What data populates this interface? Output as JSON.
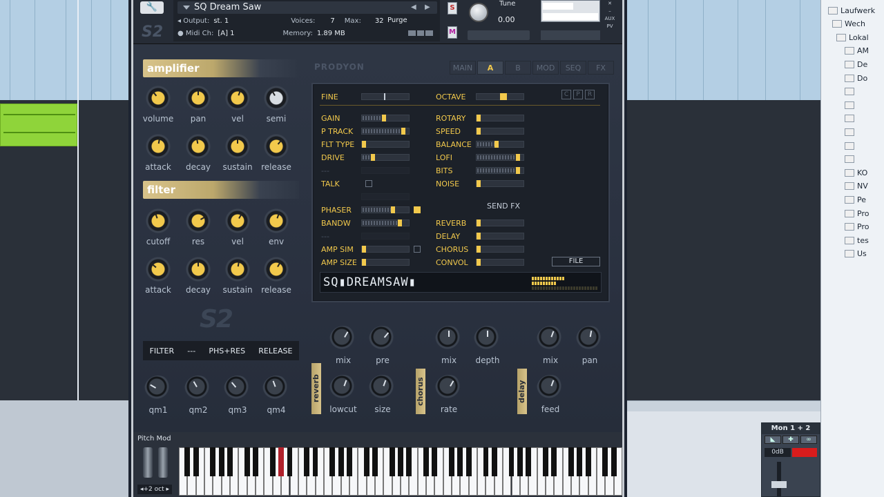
{
  "daw": {
    "browser_items": [
      "Laufwerk",
      "Wech",
      "Lokal",
      "AM",
      "De",
      "Do",
      "",
      "",
      "",
      "",
      "",
      "",
      "KO",
      "NV",
      "Pe",
      "Pro",
      "Pro",
      "tes",
      "Us"
    ],
    "mixer": {
      "title": "Mon 1 + 2",
      "level": "0dB"
    }
  },
  "header": {
    "instrument_name": "SQ Dream Saw",
    "output_label": "Output:",
    "output_value": "st. 1",
    "voices_label": "Voices:",
    "voices_value": "7",
    "max_label": "Max:",
    "max_value": "32",
    "midi_label": "Midi Ch:",
    "midi_value": "[A]  1",
    "memory_label": "Memory:",
    "memory_value": "1.89 MB",
    "purge_label": "Purge",
    "solo_label": "S",
    "mute_label": "M",
    "tune_label": "Tune",
    "tune_value": "0.00",
    "aux_label": "AUX",
    "pv_label": "PV"
  },
  "brand": "PRODYON",
  "tabs": [
    {
      "label": "MAIN",
      "active": false
    },
    {
      "label": "A",
      "active": true
    },
    {
      "label": "B",
      "active": false
    },
    {
      "label": "MOD",
      "active": false
    },
    {
      "label": "SEQ",
      "active": false
    },
    {
      "label": "FX",
      "active": false
    }
  ],
  "amplifier": {
    "title": "amplifier",
    "row1": [
      "volume",
      "pan",
      "vel",
      "semi"
    ],
    "row2": [
      "attack",
      "decay",
      "sustain",
      "release"
    ]
  },
  "filter": {
    "title": "filter",
    "row1": [
      "cutoff",
      "res",
      "vel",
      "env"
    ],
    "row2": [
      "attack",
      "decay",
      "sustain",
      "release"
    ]
  },
  "screen": {
    "fine_label": "FINE",
    "octave_label": "OCTAVE",
    "cpr": [
      "C",
      "P",
      "R"
    ],
    "left_rows": [
      {
        "label": "GAIN",
        "value": 0.5
      },
      {
        "label": "P TRACK",
        "value": 0.92
      },
      {
        "label": "FLT TYPE",
        "value": 0.05
      },
      {
        "label": "DRIVE",
        "value": 0.25
      },
      {
        "label": "---",
        "value": null
      },
      {
        "label": "TALK",
        "value": null
      },
      {
        "label": "",
        "value": null
      },
      {
        "label": "PHASER",
        "value": 0.7
      },
      {
        "label": "BANDW",
        "value": 0.85
      },
      {
        "label": "---",
        "value": null
      },
      {
        "label": "AMP SIM",
        "value": 0.05
      },
      {
        "label": "AMP SIZE",
        "value": 0.05
      }
    ],
    "right_rows": [
      {
        "label": "ROTARY",
        "value": 0.05
      },
      {
        "label": "SPEED",
        "value": 0.05
      },
      {
        "label": "BALANCE",
        "value": 0.45
      },
      {
        "label": "LOFI",
        "value": 0.92
      },
      {
        "label": "BITS",
        "value": 0.92
      },
      {
        "label": "NOISE",
        "value": 0.05
      }
    ],
    "send_fx_label": "SEND FX",
    "send_rows": [
      {
        "label": "REVERB",
        "value": 0.05
      },
      {
        "label": "DELAY",
        "value": 0.05
      },
      {
        "label": "CHORUS",
        "value": 0.05
      },
      {
        "label": "CONVOL",
        "value": 0.05
      }
    ],
    "file_label": "FILE",
    "display_text": "SQ▮DREAMSAW▮"
  },
  "qm_bar": [
    "FILTER",
    "---",
    "PHS+RES",
    "RELEASE"
  ],
  "qm_knobs": [
    "qm1",
    "qm2",
    "qm3",
    "qm4"
  ],
  "fx": {
    "reverb": {
      "tab": "reverb",
      "knobs": [
        "mix",
        "pre",
        "lowcut",
        "size"
      ]
    },
    "chorus": {
      "tab": "chorus",
      "knobs": [
        "mix",
        "depth",
        "rate"
      ]
    },
    "delay": {
      "tab": "delay",
      "knobs": [
        "mix",
        "pan",
        "feed"
      ]
    }
  },
  "keyboard": {
    "pitch_mod_label": "Pitch Mod",
    "octave_label": "◂+2 oct ▸"
  }
}
